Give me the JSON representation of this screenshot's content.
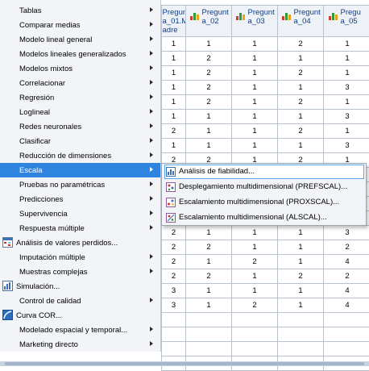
{
  "grid": {
    "columns": [
      {
        "label": "Pregunt a_01.M adre"
      },
      {
        "label": "Pregunt a_02"
      },
      {
        "label": "Pregunt a_03"
      },
      {
        "label": "Pregunt a_04"
      },
      {
        "label": "Pregu a_05"
      }
    ],
    "rows": [
      [
        "1",
        "1",
        "1",
        "2",
        "1"
      ],
      [
        "1",
        "2",
        "1",
        "1",
        "1"
      ],
      [
        "1",
        "2",
        "1",
        "2",
        "1"
      ],
      [
        "1",
        "2",
        "1",
        "1",
        "3"
      ],
      [
        "1",
        "2",
        "1",
        "2",
        "1"
      ],
      [
        "1",
        "1",
        "1",
        "1",
        "3"
      ],
      [
        "2",
        "1",
        "1",
        "2",
        "1"
      ],
      [
        "1",
        "1",
        "1",
        "1",
        "3"
      ],
      [
        "2",
        "2",
        "1",
        "2",
        "1"
      ],
      [
        "",
        "",
        "",
        "",
        ""
      ],
      [
        "",
        "",
        "",
        "",
        ""
      ],
      [
        "",
        "",
        "",
        "",
        ""
      ],
      [
        "",
        "",
        "",
        "",
        ""
      ],
      [
        "2",
        "1",
        "1",
        "1",
        "3"
      ],
      [
        "2",
        "2",
        "1",
        "1",
        "2"
      ],
      [
        "2",
        "1",
        "2",
        "1",
        "4"
      ],
      [
        "2",
        "2",
        "1",
        "2",
        "2"
      ],
      [
        "3",
        "1",
        "1",
        "1",
        "4"
      ],
      [
        "3",
        "1",
        "2",
        "1",
        "4"
      ],
      [
        "",
        "",
        "",
        "",
        ""
      ],
      [
        "",
        "",
        "",
        "",
        ""
      ],
      [
        "",
        "",
        "",
        "",
        ""
      ],
      [
        "",
        "",
        "",
        "",
        ""
      ]
    ]
  },
  "menu": {
    "items": [
      {
        "label": "Tablas",
        "arrow": true
      },
      {
        "label": "Comparar medias",
        "arrow": true
      },
      {
        "label": "Modelo lineal general",
        "arrow": true
      },
      {
        "label": "Modelos lineales generalizados",
        "arrow": true
      },
      {
        "label": "Modelos mixtos",
        "arrow": true
      },
      {
        "label": "Correlacionar",
        "arrow": true
      },
      {
        "label": "Regresión",
        "arrow": true
      },
      {
        "label": "Loglineal",
        "arrow": true
      },
      {
        "label": "Redes neuronales",
        "arrow": true
      },
      {
        "label": "Clasificar",
        "arrow": true
      },
      {
        "label": "Reducción de dimensiones",
        "arrow": true
      },
      {
        "label": "Escala",
        "arrow": true,
        "selected": true
      },
      {
        "label": "Pruebas no paramétricas",
        "arrow": true
      },
      {
        "label": "Predicciones",
        "arrow": true
      },
      {
        "label": "Supervivencia",
        "arrow": true
      },
      {
        "label": "Respuesta múltiple",
        "arrow": true
      },
      {
        "label": "Análisis de valores perdidos...",
        "arrow": false,
        "icon": "missing-values-icon"
      },
      {
        "label": "Imputación múltiple",
        "arrow": true
      },
      {
        "label": "Muestras complejas",
        "arrow": true
      },
      {
        "label": "Simulación...",
        "arrow": false,
        "icon": "simulation-icon"
      },
      {
        "label": "Control de calidad",
        "arrow": true
      },
      {
        "label": "Curva COR...",
        "arrow": false,
        "icon": "roc-curve-icon"
      },
      {
        "label": "Modelado espacial y temporal...",
        "arrow": true
      },
      {
        "label": "Marketing directo",
        "arrow": true
      }
    ]
  },
  "submenu": {
    "items": [
      {
        "label": "Análisis de fiabilidad...",
        "icon": "reliability-icon",
        "selected": true
      },
      {
        "label": "Desplegamiento multidimensional (PREFSCAL)...",
        "icon": "prefscal-icon"
      },
      {
        "label": "Escalamiento multidimensional (PROXSCAL)...",
        "icon": "proxscal-icon"
      },
      {
        "label": "Escalamiento multidimensional (ALSCAL)...",
        "icon": "alscal-icon"
      }
    ]
  },
  "colors": {
    "menu_bg": "#f2f4f7",
    "selection": "#2f84e0",
    "header_text": "#0f3f8a",
    "grid_line": "#b9c3cf"
  }
}
